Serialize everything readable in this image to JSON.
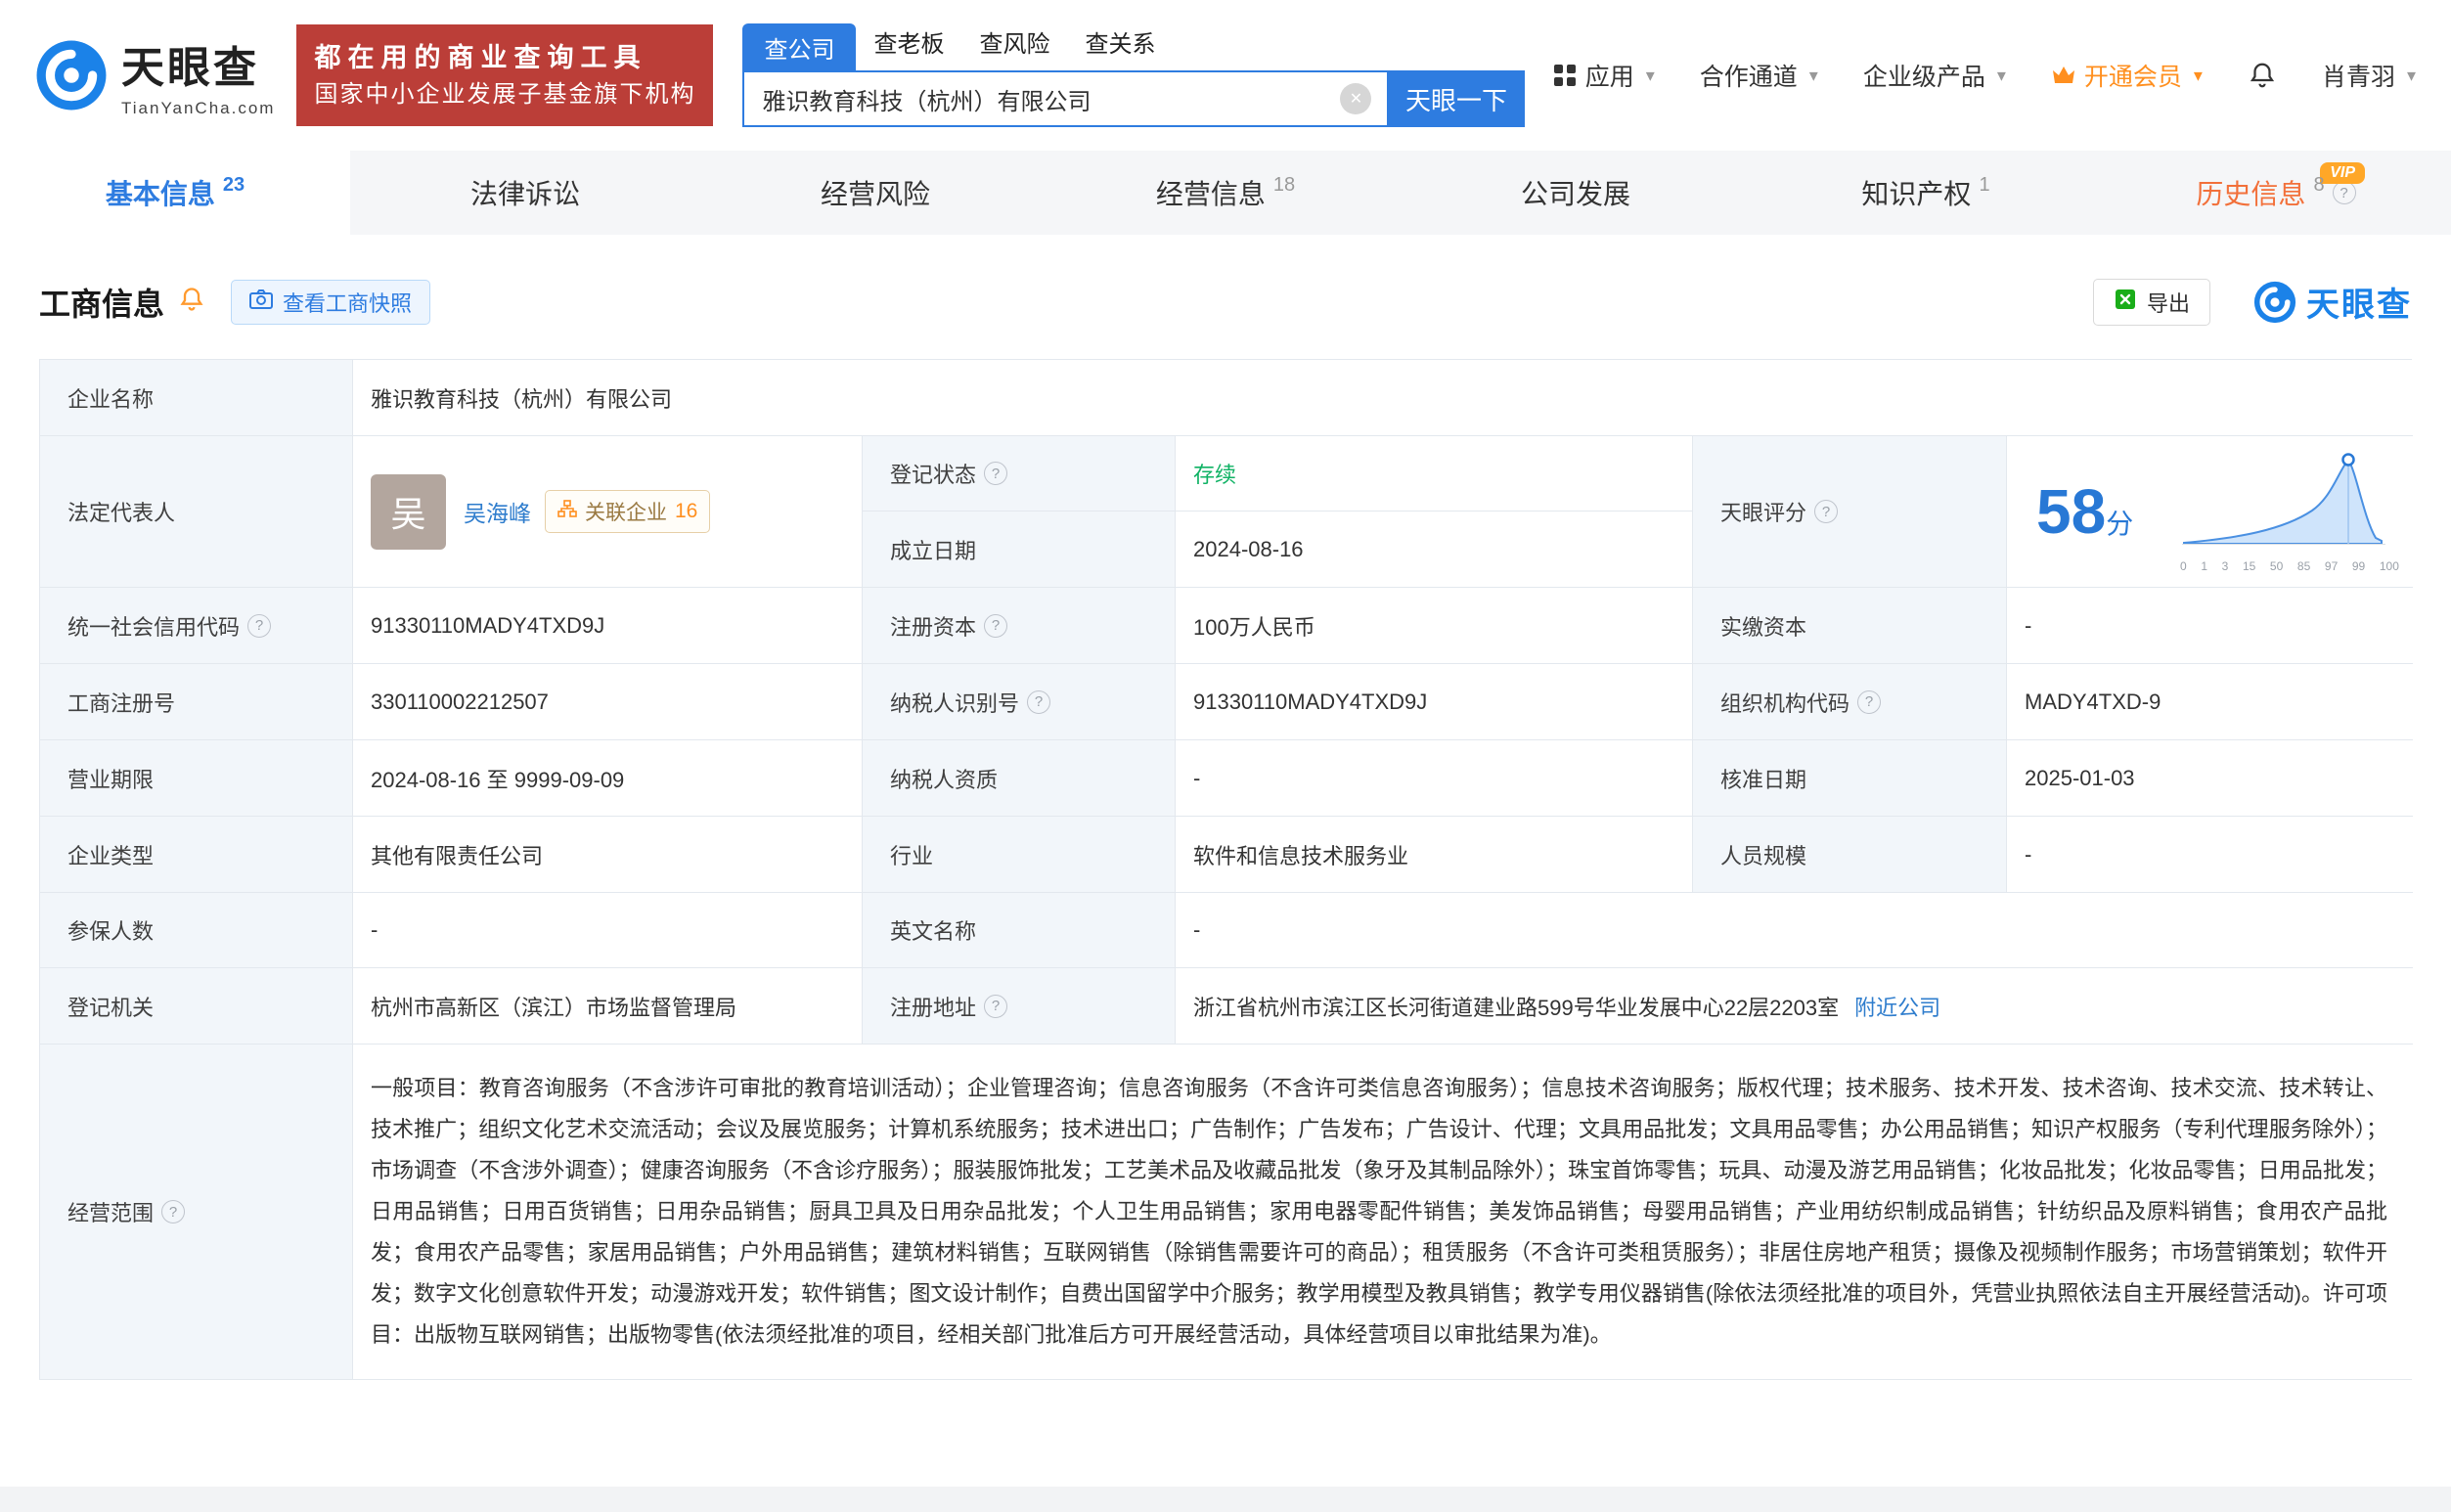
{
  "header": {
    "logo": {
      "cn": "天眼查",
      "en": "TianYanCha.com"
    },
    "banner": {
      "line1": "都在用的商业查询工具",
      "line2": "国家中小企业发展子基金旗下机构"
    },
    "search": {
      "tabs": [
        {
          "label": "查公司"
        },
        {
          "label": "查老板"
        },
        {
          "label": "查风险"
        },
        {
          "label": "查关系"
        }
      ],
      "value": "雅识教育科技（杭州）有限公司",
      "button": "天眼一下"
    },
    "nav": {
      "apps": "应用",
      "partner": "合作通道",
      "enterprise": "企业级产品",
      "vip": "开通会员",
      "user": "肖青羽"
    }
  },
  "tabs": {
    "basic": {
      "label": "基本信息",
      "count": "23"
    },
    "legal": {
      "label": "法律诉讼"
    },
    "risk": {
      "label": "经营风险"
    },
    "operation": {
      "label": "经营信息",
      "count": "18"
    },
    "development": {
      "label": "公司发展"
    },
    "ip": {
      "label": "知识产权",
      "count": "1"
    },
    "history": {
      "label": "历史信息",
      "count": "8",
      "badge": "VIP"
    }
  },
  "section": {
    "title": "工商信息",
    "snapshot": "查看工商快照",
    "export": "导出",
    "watermark": "天眼查"
  },
  "table": {
    "company_name": {
      "label": "企业名称",
      "value": "雅识教育科技（杭州）有限公司"
    },
    "legal_rep": {
      "label": "法定代表人",
      "avatar": "吴",
      "name": "吴海峰",
      "related": "关联企业",
      "related_count": "16"
    },
    "status": {
      "label": "登记状态",
      "value": "存续"
    },
    "established": {
      "label": "成立日期",
      "value": "2024-08-16"
    },
    "score": {
      "label": "天眼评分",
      "value": "58",
      "unit": "分",
      "axis": [
        "0",
        "1",
        "3",
        "15",
        "50",
        "85",
        "97",
        "99",
        "100"
      ]
    },
    "credit_code": {
      "label": "统一社会信用代码",
      "value": "91330110MADY4TXD9J"
    },
    "reg_capital": {
      "label": "注册资本",
      "value": "100万人民币"
    },
    "paid_capital": {
      "label": "实缴资本",
      "value": "-"
    },
    "reg_number": {
      "label": "工商注册号",
      "value": "330110002212507"
    },
    "taxpayer_id": {
      "label": "纳税人识别号",
      "value": "91330110MADY4TXD9J"
    },
    "org_code": {
      "label": "组织机构代码",
      "value": "MADY4TXD-9"
    },
    "term": {
      "label": "营业期限",
      "value": "2024-08-16 至 9999-09-09"
    },
    "taxpayer_quality": {
      "label": "纳税人资质",
      "value": "-"
    },
    "approval_date": {
      "label": "核准日期",
      "value": "2025-01-03"
    },
    "company_type": {
      "label": "企业类型",
      "value": "其他有限责任公司"
    },
    "industry": {
      "label": "行业",
      "value": "软件和信息技术服务业"
    },
    "staff": {
      "label": "人员规模",
      "value": "-"
    },
    "insured": {
      "label": "参保人数",
      "value": "-"
    },
    "english_name": {
      "label": "英文名称",
      "value": "-"
    },
    "authority": {
      "label": "登记机关",
      "value": "杭州市高新区（滨江）市场监督管理局"
    },
    "address": {
      "label": "注册地址",
      "value": "浙江省杭州市滨江区长河街道建业路599号华业发展中心22层2203室",
      "nearby": "附近公司"
    },
    "scope": {
      "label": "经营范围",
      "value": "一般项目：教育咨询服务（不含涉许可审批的教育培训活动）；企业管理咨询；信息咨询服务（不含许可类信息咨询服务）；信息技术咨询服务；版权代理；技术服务、技术开发、技术咨询、技术交流、技术转让、技术推广；组织文化艺术交流活动；会议及展览服务；计算机系统服务；技术进出口；广告制作；广告发布；广告设计、代理；文具用品批发；文具用品零售；办公用品销售；知识产权服务（专利代理服务除外）；市场调查（不含涉外调查）；健康咨询服务（不含诊疗服务）；服装服饰批发；工艺美术品及收藏品批发（象牙及其制品除外）；珠宝首饰零售；玩具、动漫及游艺用品销售；化妆品批发；化妆品零售；日用品批发；日用品销售；日用百货销售；日用杂品销售；厨具卫具及日用杂品批发；个人卫生用品销售；家用电器零配件销售；美发饰品销售；母婴用品销售；产业用纺织制成品销售；针纺织品及原料销售；食用农产品批发；食用农产品零售；家居用品销售；户外用品销售；建筑材料销售；互联网销售（除销售需要许可的商品）；租赁服务（不含许可类租赁服务）；非居住房地产租赁；摄像及视频制作服务；市场营销策划；软件开发；数字文化创意软件开发；动漫游戏开发；软件销售；图文设计制作；自费出国留学中介服务；教学用模型及教具销售；教学专用仪器销售(除依法须经批准的项目外，凭营业执照依法自主开展经营活动)。许可项目：出版物互联网销售；出版物零售(依法须经批准的项目，经相关部门批准后方可开展经营活动，具体经营项目以审批结果为准)。"
    }
  }
}
